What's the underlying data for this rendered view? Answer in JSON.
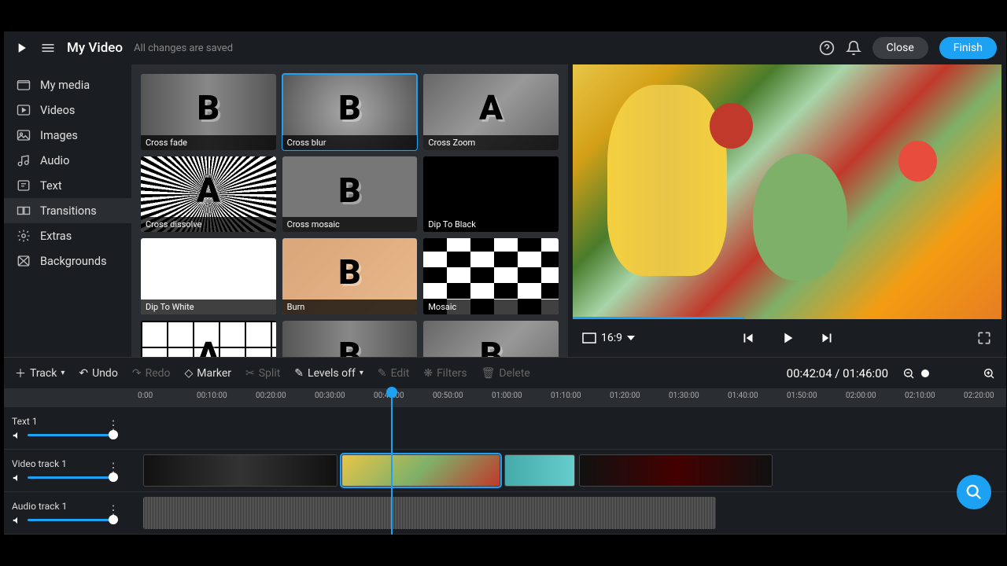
{
  "header": {
    "title": "My Video",
    "save_status": "All changes are saved",
    "close": "Close",
    "finish": "Finish"
  },
  "sidebar": {
    "items": [
      {
        "label": "My media",
        "icon": "folder"
      },
      {
        "label": "Videos",
        "icon": "video"
      },
      {
        "label": "Images",
        "icon": "image"
      },
      {
        "label": "Audio",
        "icon": "audio"
      },
      {
        "label": "Text",
        "icon": "text"
      },
      {
        "label": "Transitions",
        "icon": "transitions"
      },
      {
        "label": "Extras",
        "icon": "extras"
      },
      {
        "label": "Backgrounds",
        "icon": "backgrounds"
      }
    ]
  },
  "transitions": [
    {
      "label": "Cross fade",
      "letter": "B",
      "cls": "thumb-crossfade"
    },
    {
      "label": "Cross blur",
      "letter": "B",
      "cls": "thumb-crossblur",
      "selected": true
    },
    {
      "label": "Cross Zoom",
      "letter": "A",
      "cls": "thumb-crosszoom"
    },
    {
      "label": "Cross dissolve",
      "letter": "A",
      "cls": "thumb-dissolve"
    },
    {
      "label": "Cross mosaic",
      "letter": "B",
      "cls": "thumb-mosaic"
    },
    {
      "label": "Dip To Black",
      "letter": "",
      "cls": "thumb-dipblack"
    },
    {
      "label": "Dip To White",
      "letter": "",
      "cls": "thumb-dipwhite"
    },
    {
      "label": "Burn",
      "letter": "B",
      "cls": "thumb-burn"
    },
    {
      "label": "Mosaic",
      "letter": "",
      "cls": "thumb-mosaic2"
    },
    {
      "label": "",
      "letter": "A",
      "cls": "thumb-grid"
    },
    {
      "label": "",
      "letter": "B",
      "cls": "thumb-crossfade"
    },
    {
      "label": "",
      "letter": "B",
      "cls": "thumb-crosszoom"
    }
  ],
  "preview": {
    "aspect": "16:9",
    "progress_pct": 40
  },
  "toolbar": {
    "track": "Track",
    "undo": "Undo",
    "redo": "Redo",
    "marker": "Marker",
    "split": "Split",
    "levels": "Levels off",
    "edit": "Edit",
    "filters": "Filters",
    "delete": "Delete",
    "timecode": "00:42:04 / 01:46:00"
  },
  "ruler": [
    "0:00",
    "00:10:00",
    "00:20:00",
    "00:30:00",
    "00:40:00",
    "00:50:00",
    "01:00:00",
    "01:10:00",
    "01:20:00",
    "01:30:00",
    "01:40:00",
    "01:50:00",
    "02:00:00",
    "02:10:00",
    "02:20:00"
  ],
  "tracks": [
    {
      "name": "Text 1"
    },
    {
      "name": "Video track 1"
    },
    {
      "name": "Audio track 1"
    }
  ],
  "playhead_pct": 29
}
